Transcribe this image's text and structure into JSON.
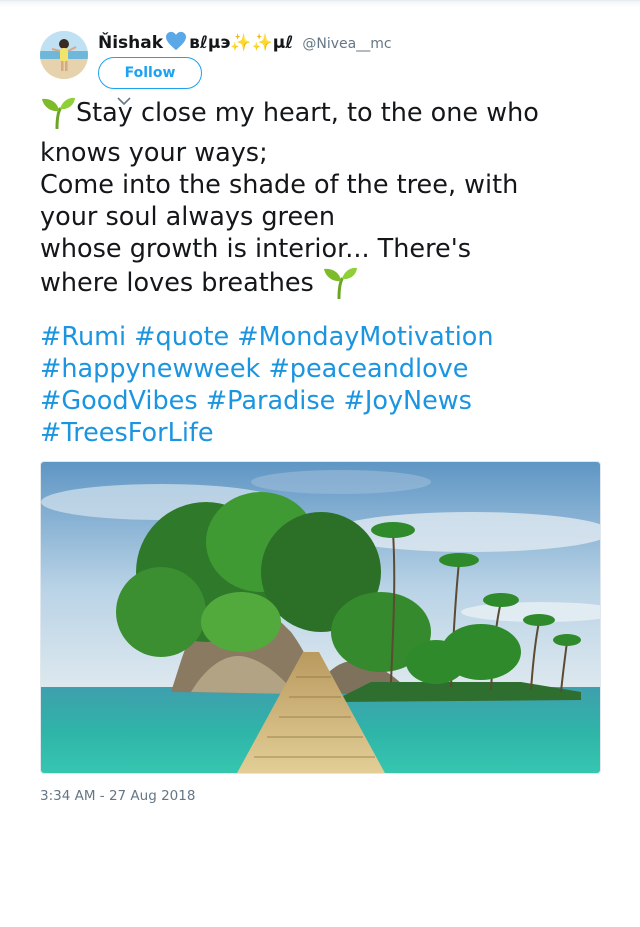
{
  "user": {
    "display_name": "Ňishak",
    "name_suffix": "вℓμэ✨✨μℓ",
    "handle": "@Nivea__mc"
  },
  "follow_label": "Follow",
  "tweet": {
    "lines": [
      "Stay close my heart, to the one who",
      "knows your ways;",
      "Come into the shade of the tree, with",
      "your soul always green",
      "whose growth is interior... There's",
      "where loves breathes"
    ]
  },
  "hashtags": [
    [
      "#Rumi",
      "#quote",
      "#MondayMotivation"
    ],
    [
      "#happynewweek",
      "#peaceandlove"
    ],
    [
      "#GoodVibes",
      "#Paradise",
      "#JoyNews"
    ],
    [
      "#TreesForLife"
    ]
  ],
  "timestamp": "3:34 AM - 27 Aug 2018",
  "colors": {
    "link": "#1b95e0",
    "follow": "#1da1f2",
    "text": "#14171a",
    "muted": "#657786",
    "heart": "#5aa8e8",
    "sprout": "#7dbb2a"
  },
  "icons": {
    "heart": "blue-heart-icon",
    "sprout": "seedling-icon",
    "caret": "chevron-down-icon"
  }
}
